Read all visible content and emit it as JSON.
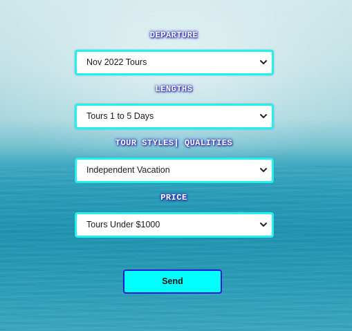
{
  "form": {
    "departure": {
      "label": "DEPARTURE",
      "selected": "Nov 2022 Tours"
    },
    "lengths": {
      "label": "LENGTHS",
      "selected": "Tours 1 to 5 Days"
    },
    "styles": {
      "label": "TOUR STYLES| QUALITIES",
      "selected": "Independent Vacation"
    },
    "price": {
      "label": "PRICE",
      "selected": "Tours Under $1000"
    },
    "send_label": "Send"
  },
  "icons": {
    "dropdown": "chevron-down-icon"
  },
  "colors": {
    "select_border": "#22f0f0",
    "button_bg": "#00ffff",
    "button_border": "#1b1bd6",
    "label_glow": "#2b2bb0"
  }
}
